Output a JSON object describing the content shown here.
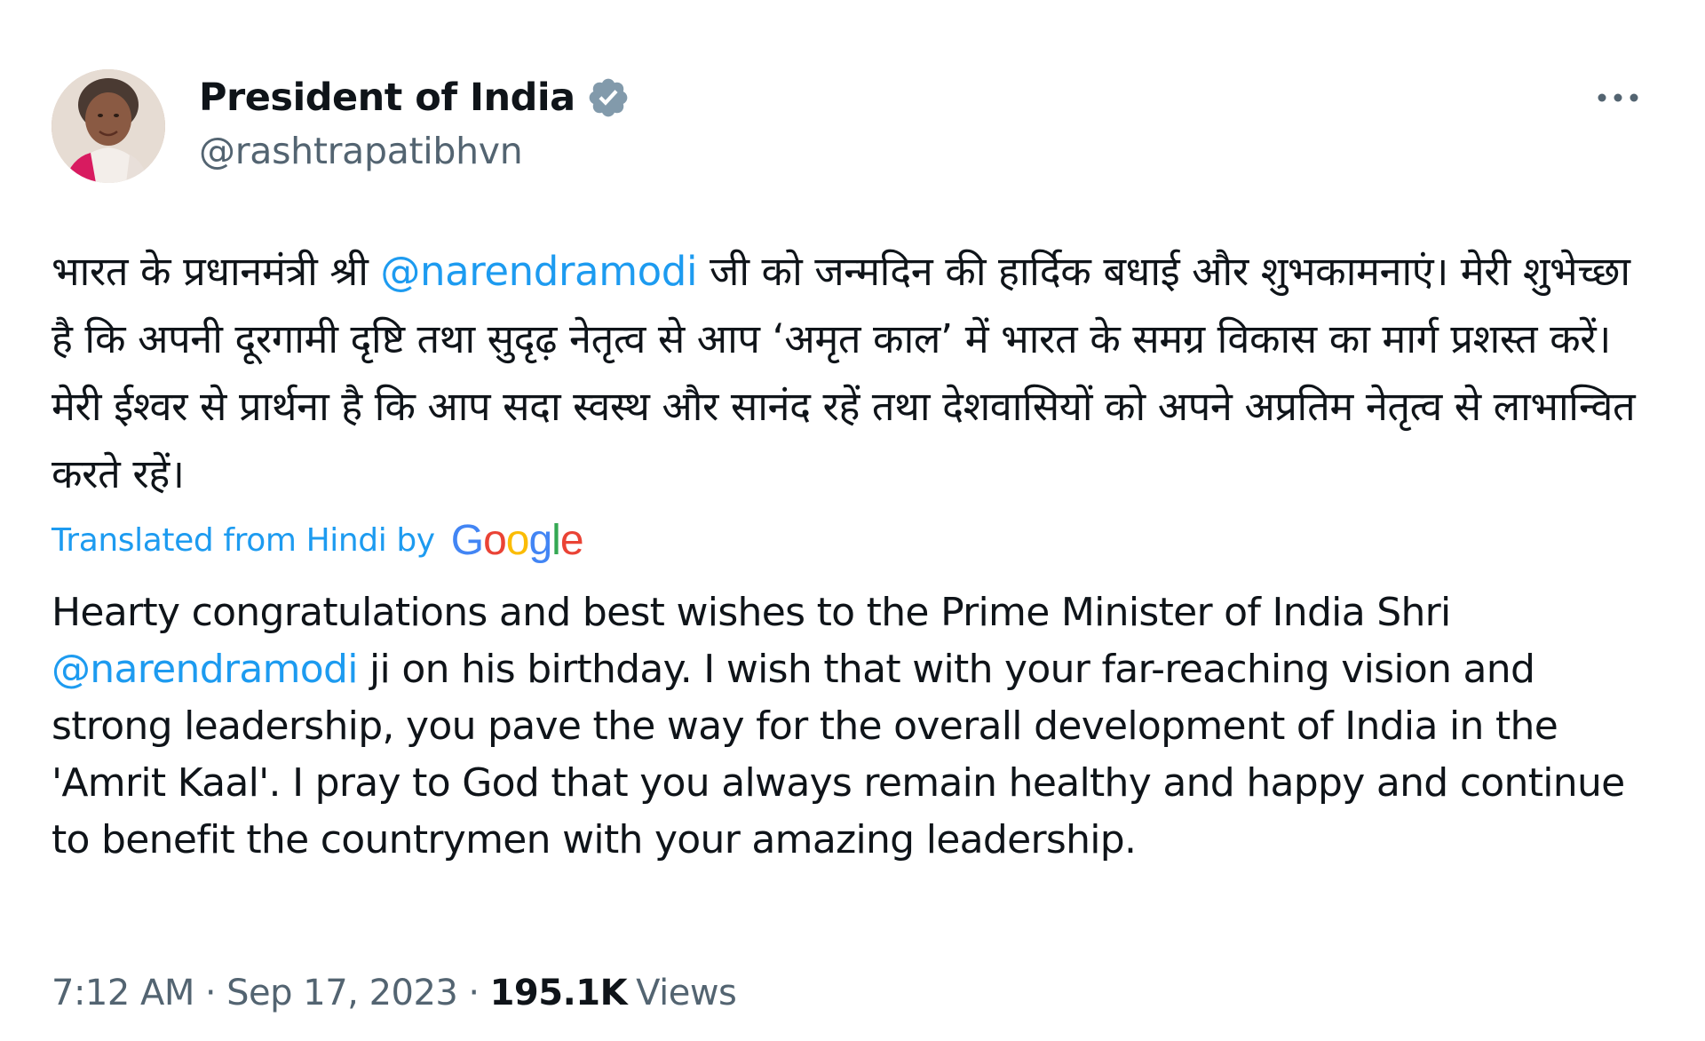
{
  "author": {
    "display_name": "President of India",
    "handle": "@rashtrapatibhvn",
    "verified": true
  },
  "more_label": "More",
  "tweet": {
    "hindi": {
      "line1_before": "भारत के प्रधानमंत्री श्री ",
      "mention": "@narendramodi",
      "line1_after": " जी को जन्मदिन की हार्दिक बधाई और शुभकामनाएं। मेरी शुभेच्छा है कि अपनी दूरगामी दृष्टि तथा सुदृढ़ नेतृत्व से आप ‘अमृत काल’ में भारत के समग्र विकास का मार्ग प्रशस्त करें। मेरी ईश्वर से प्रार्थना है कि आप सदा स्वस्थ और सानंद रहें तथा देशवासियों को अपने अप्रतिम नेतृत्व से लाभान्वित करते रहें।"
    },
    "translated_label": "Translated from Hindi by",
    "google_logo": "Google",
    "english": {
      "before": "Hearty congratulations and best wishes to the Prime Minister of India Shri ",
      "mention": "@narendramodi",
      "after": " ji on his birthday. I wish that with your far-reaching vision and strong leadership, you pave the way for the overall development of India in the 'Amrit Kaal'. I pray to God that you always remain healthy and happy and continue to benefit the countrymen with your amazing leadership."
    }
  },
  "meta": {
    "time": "7:12 AM",
    "separator": "·",
    "date": "Sep 17, 2023",
    "views_count": "195.1K",
    "views_label": "Views"
  },
  "colors": {
    "link": "#1d9bf0",
    "text": "#0f1419",
    "secondary": "#536471",
    "verified_badge": "#829aab"
  },
  "icons": {
    "verified": "verified-badge-icon",
    "more": "more-horizontal-icon"
  }
}
